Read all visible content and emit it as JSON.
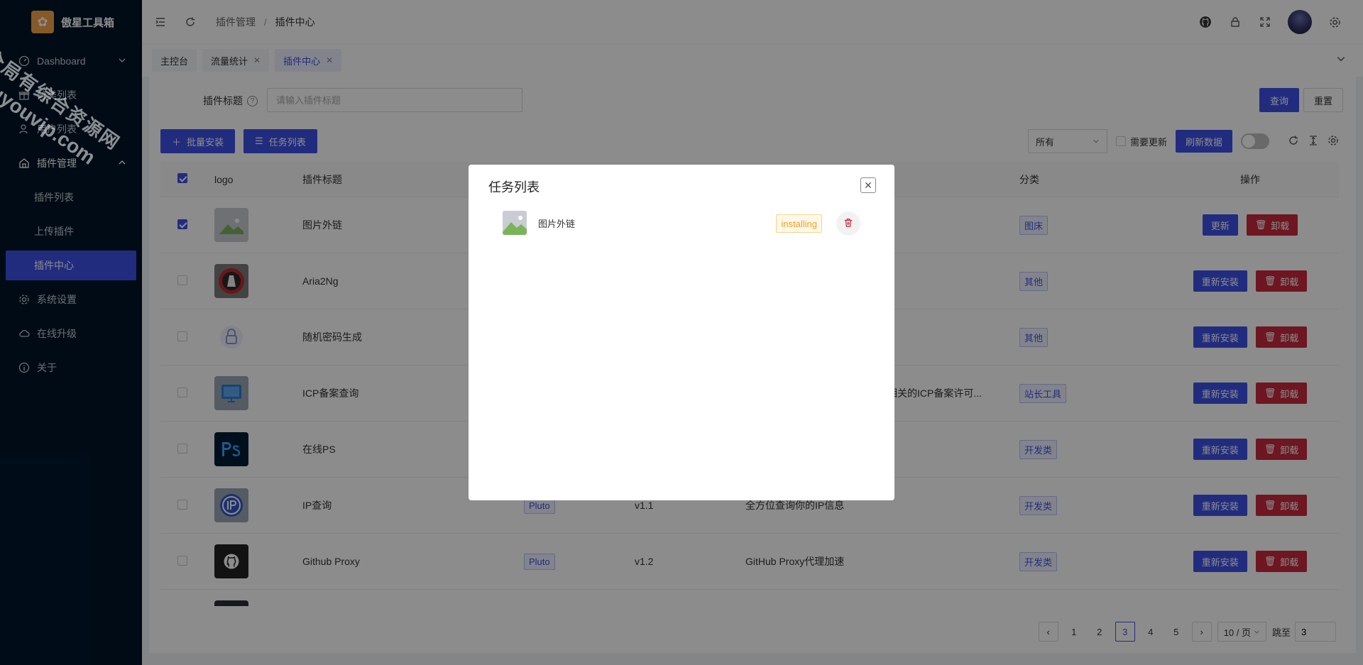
{
  "brand": {
    "name": "傲星工具箱"
  },
  "sidebar": {
    "items": [
      {
        "label": "Dashboard",
        "icon": "dashboard-icon"
      },
      {
        "label": "分类列表",
        "icon": "gift-icon"
      },
      {
        "label": "用户列表",
        "icon": "user-icon"
      },
      {
        "label": "插件管理",
        "icon": "plugin-icon"
      },
      {
        "label": "系统设置",
        "icon": "gear-icon"
      },
      {
        "label": "在线升级",
        "icon": "cloud-icon"
      },
      {
        "label": "关于",
        "icon": "info-icon"
      }
    ],
    "sub_items": [
      {
        "label": "插件列表"
      },
      {
        "label": "上传插件"
      },
      {
        "label": "插件中心"
      }
    ]
  },
  "header": {
    "breadcrumb": [
      "插件管理",
      "插件中心"
    ],
    "separator": "/"
  },
  "tabs": [
    {
      "label": "主控台"
    },
    {
      "label": "流量统计"
    },
    {
      "label": "插件中心"
    }
  ],
  "search": {
    "label": "插件标题",
    "placeholder": "请输入插件标题",
    "query_button": "查询",
    "reset_button": "重置"
  },
  "toolbar": {
    "batch_install": "批量安装",
    "task_list": "任务列表",
    "filter_value": "所有",
    "need_update": "需要更新",
    "refresh_data": "刷新数据"
  },
  "table": {
    "headers": {
      "logo": "logo",
      "title": "插件标题",
      "category": "分类",
      "ops": "操作"
    },
    "rows": [
      {
        "title": "图片外链",
        "author": "",
        "version": "",
        "desc": "",
        "category": "图床",
        "primary_op": "更新",
        "uninstall": "卸载"
      },
      {
        "title": "Aria2Ng",
        "author": "",
        "version": "",
        "desc": "",
        "category": "其他",
        "primary_op": "重新安装",
        "uninstall": "卸载"
      },
      {
        "title": "随机密码生成",
        "author": "",
        "version": "",
        "desc": "",
        "category": "其他",
        "primary_op": "重新安装",
        "uninstall": "卸载"
      },
      {
        "title": "ICP备案查询",
        "author": "",
        "version": "",
        "desc": "及相关的ICP备案许可...",
        "category": "站长工具",
        "primary_op": "重新安装",
        "uninstall": "卸载"
      },
      {
        "title": "在线PS",
        "author": "",
        "version": "",
        "desc": "",
        "category": "开发类",
        "primary_op": "重新安装",
        "uninstall": "卸载"
      },
      {
        "title": "IP查询",
        "author": "Pluto",
        "version": "v1.1",
        "desc": "全方位查询你的IP信息",
        "category": "开发类",
        "primary_op": "重新安装",
        "uninstall": "卸载"
      },
      {
        "title": "Github Proxy",
        "author": "Pluto",
        "version": "v1.2",
        "desc": "GitHub Proxy代理加速",
        "category": "开发类",
        "primary_op": "重新安装",
        "uninstall": "卸载"
      }
    ]
  },
  "pager": {
    "pages": [
      "1",
      "2",
      "3",
      "4",
      "5"
    ],
    "current": "3",
    "size": "10 / 页",
    "jump_label": "跳至",
    "jump_value": "3"
  },
  "modal": {
    "title": "任务列表",
    "task": {
      "name": "图片外链",
      "status": "installing"
    }
  },
  "watermark": {
    "line1": "全局有综合资源网",
    "line2": "douyouvip.com"
  },
  "colors": {
    "primary": "#3f51e8",
    "danger": "#c8283c",
    "sidebar": "#001529",
    "warning": "#f0a020"
  }
}
